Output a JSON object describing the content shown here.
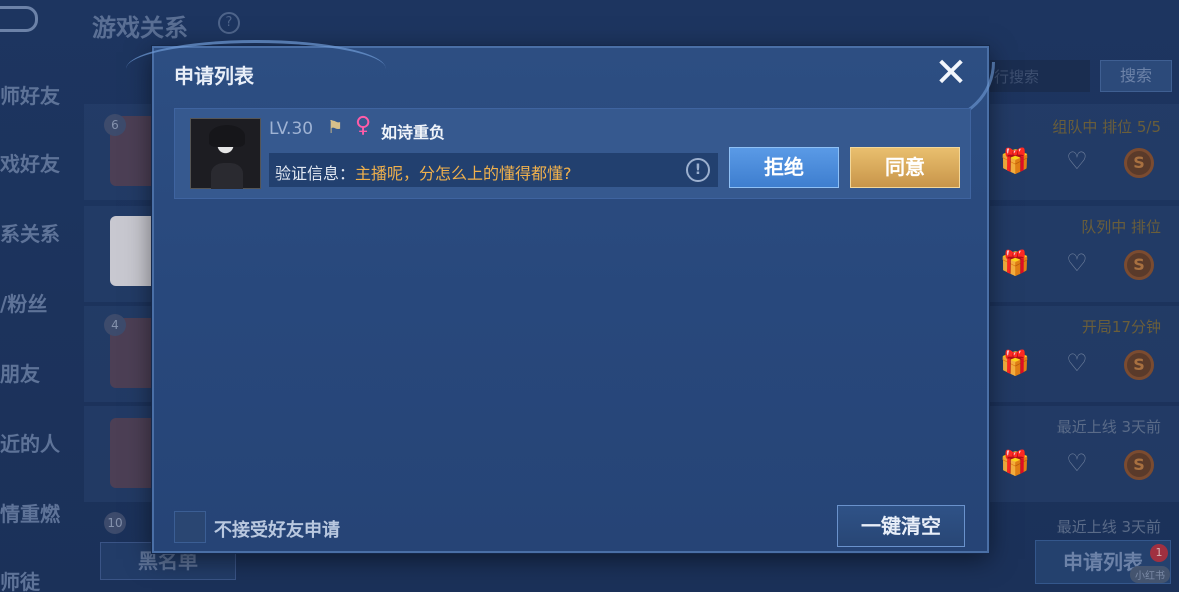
{
  "background": {
    "title": "游戏关系",
    "help_icon": "?",
    "sidebar": [
      "师好友",
      "戏好友",
      "系关系",
      "/粉丝",
      "朋友",
      "近的人",
      "情重燃",
      "师徒"
    ],
    "search_placeholder": "行搜索",
    "search_button": "搜索",
    "rows": [
      {
        "status": "组队中 排位 5/5",
        "level": "6"
      },
      {
        "status": "队列中 排位",
        "level": ""
      },
      {
        "status": "开局17分钟",
        "level": "4"
      },
      {
        "status": "最近上线  3天前",
        "level": ""
      },
      {
        "status": "最近上线  3天前",
        "level": "10"
      }
    ],
    "blacklist_button": "黑名单",
    "apply_list_button": "申请列表",
    "apply_badge": "1",
    "watermark": "小红书"
  },
  "modal": {
    "title": "申请列表",
    "close_icon": "✕",
    "requests": [
      {
        "level": "LV.30",
        "rank_icon": "rank-banner-icon",
        "gender_icon": "♀",
        "nickname": "如诗重负",
        "verify_label": "验证信息：",
        "verify_message": "主播呢，分怎么上的懂得都懂?",
        "reject_label": "拒绝",
        "accept_label": "同意"
      }
    ],
    "decline_all_label": "不接受好友申请",
    "clear_all_label": "一键清空"
  },
  "colors": {
    "accent_blue": "#4a8ad9",
    "accent_gold": "#d9a65a",
    "verify_text": "#f0b04c",
    "female_pink": "#ff5ca8"
  }
}
